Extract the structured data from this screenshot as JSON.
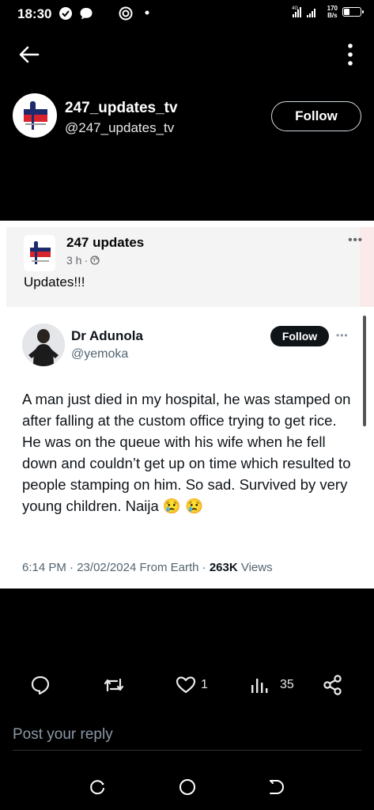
{
  "status_bar": {
    "time": "18:30",
    "network_speed": "170",
    "network_unit": "B/s",
    "network_type": "4G",
    "battery_level": 0.35,
    "icons": [
      "notification-badge-icon",
      "chat-bubble-icon",
      "sync-app-icon",
      "dot-icon",
      "signal-icon",
      "battery-icon"
    ]
  },
  "header": {
    "back_icon": "arrow-left-icon",
    "more_icon": "more-vertical-icon"
  },
  "profile": {
    "name": "247_updates_tv",
    "handle": "@247_updates_tv",
    "follow_label": "Follow"
  },
  "media": {
    "facebook_post": {
      "page_name": "247 updates",
      "time": "3 h",
      "text": "Updates!!!",
      "more": "•••"
    },
    "tweet": {
      "author_name": "Dr Adunola",
      "author_handle": "@yemoka",
      "follow_label": "Follow",
      "more": "•••",
      "body": "A man just died in my hospital, he was stamped on after falling at the custom office trying to get rice. He was on the queue with his wife when he fell down and couldn’t get up on time which resulted to people stamping on him. So sad. Survived by very young children. Naija 😢 😢",
      "time": "6:14 PM",
      "date": "23/02/2024",
      "source": "From Earth",
      "views_count": "263K",
      "views_label": "Views"
    }
  },
  "actions": {
    "reply_icon": "reply-icon",
    "repost_icon": "repost-icon",
    "like_icon": "heart-icon",
    "like_count": "1",
    "views_icon": "analytics-icon",
    "views_count": "35",
    "share_icon": "share-icon"
  },
  "reply": {
    "placeholder": "Post your reply"
  },
  "system_nav": {
    "recents_icon": "recents-icon",
    "home_icon": "home-icon",
    "back_icon": "back-icon"
  },
  "colors": {
    "background": "#000000",
    "text_primary": "#e7e9ea",
    "text_secondary": "#8b98a5",
    "tweet_text": "#0f1419",
    "tweet_muted": "#536471",
    "logo_red": "#d9232d",
    "logo_navy": "#1d2a6b"
  }
}
